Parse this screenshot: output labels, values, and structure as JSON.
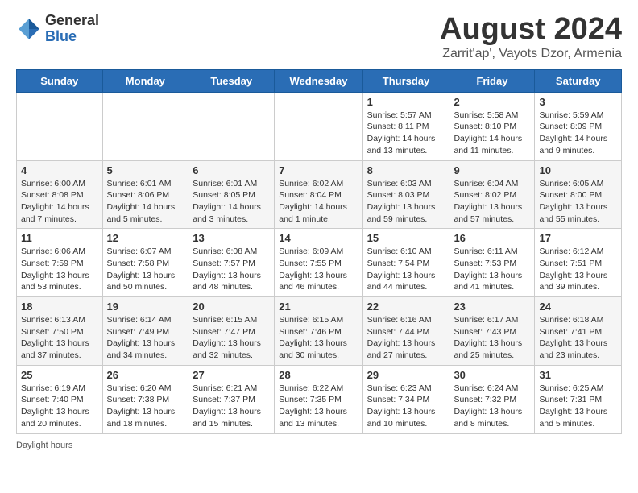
{
  "header": {
    "logo_general": "General",
    "logo_blue": "Blue",
    "main_title": "August 2024",
    "subtitle": "Zarrit'ap', Vayots Dzor, Armenia"
  },
  "weekdays": [
    "Sunday",
    "Monday",
    "Tuesday",
    "Wednesday",
    "Thursday",
    "Friday",
    "Saturday"
  ],
  "weeks": [
    [
      {
        "day": "",
        "info": ""
      },
      {
        "day": "",
        "info": ""
      },
      {
        "day": "",
        "info": ""
      },
      {
        "day": "",
        "info": ""
      },
      {
        "day": "1",
        "info": "Sunrise: 5:57 AM\nSunset: 8:11 PM\nDaylight: 14 hours and 13 minutes."
      },
      {
        "day": "2",
        "info": "Sunrise: 5:58 AM\nSunset: 8:10 PM\nDaylight: 14 hours and 11 minutes."
      },
      {
        "day": "3",
        "info": "Sunrise: 5:59 AM\nSunset: 8:09 PM\nDaylight: 14 hours and 9 minutes."
      }
    ],
    [
      {
        "day": "4",
        "info": "Sunrise: 6:00 AM\nSunset: 8:08 PM\nDaylight: 14 hours and 7 minutes."
      },
      {
        "day": "5",
        "info": "Sunrise: 6:01 AM\nSunset: 8:06 PM\nDaylight: 14 hours and 5 minutes."
      },
      {
        "day": "6",
        "info": "Sunrise: 6:01 AM\nSunset: 8:05 PM\nDaylight: 14 hours and 3 minutes."
      },
      {
        "day": "7",
        "info": "Sunrise: 6:02 AM\nSunset: 8:04 PM\nDaylight: 14 hours and 1 minute."
      },
      {
        "day": "8",
        "info": "Sunrise: 6:03 AM\nSunset: 8:03 PM\nDaylight: 13 hours and 59 minutes."
      },
      {
        "day": "9",
        "info": "Sunrise: 6:04 AM\nSunset: 8:02 PM\nDaylight: 13 hours and 57 minutes."
      },
      {
        "day": "10",
        "info": "Sunrise: 6:05 AM\nSunset: 8:00 PM\nDaylight: 13 hours and 55 minutes."
      }
    ],
    [
      {
        "day": "11",
        "info": "Sunrise: 6:06 AM\nSunset: 7:59 PM\nDaylight: 13 hours and 53 minutes."
      },
      {
        "day": "12",
        "info": "Sunrise: 6:07 AM\nSunset: 7:58 PM\nDaylight: 13 hours and 50 minutes."
      },
      {
        "day": "13",
        "info": "Sunrise: 6:08 AM\nSunset: 7:57 PM\nDaylight: 13 hours and 48 minutes."
      },
      {
        "day": "14",
        "info": "Sunrise: 6:09 AM\nSunset: 7:55 PM\nDaylight: 13 hours and 46 minutes."
      },
      {
        "day": "15",
        "info": "Sunrise: 6:10 AM\nSunset: 7:54 PM\nDaylight: 13 hours and 44 minutes."
      },
      {
        "day": "16",
        "info": "Sunrise: 6:11 AM\nSunset: 7:53 PM\nDaylight: 13 hours and 41 minutes."
      },
      {
        "day": "17",
        "info": "Sunrise: 6:12 AM\nSunset: 7:51 PM\nDaylight: 13 hours and 39 minutes."
      }
    ],
    [
      {
        "day": "18",
        "info": "Sunrise: 6:13 AM\nSunset: 7:50 PM\nDaylight: 13 hours and 37 minutes."
      },
      {
        "day": "19",
        "info": "Sunrise: 6:14 AM\nSunset: 7:49 PM\nDaylight: 13 hours and 34 minutes."
      },
      {
        "day": "20",
        "info": "Sunrise: 6:15 AM\nSunset: 7:47 PM\nDaylight: 13 hours and 32 minutes."
      },
      {
        "day": "21",
        "info": "Sunrise: 6:15 AM\nSunset: 7:46 PM\nDaylight: 13 hours and 30 minutes."
      },
      {
        "day": "22",
        "info": "Sunrise: 6:16 AM\nSunset: 7:44 PM\nDaylight: 13 hours and 27 minutes."
      },
      {
        "day": "23",
        "info": "Sunrise: 6:17 AM\nSunset: 7:43 PM\nDaylight: 13 hours and 25 minutes."
      },
      {
        "day": "24",
        "info": "Sunrise: 6:18 AM\nSunset: 7:41 PM\nDaylight: 13 hours and 23 minutes."
      }
    ],
    [
      {
        "day": "25",
        "info": "Sunrise: 6:19 AM\nSunset: 7:40 PM\nDaylight: 13 hours and 20 minutes."
      },
      {
        "day": "26",
        "info": "Sunrise: 6:20 AM\nSunset: 7:38 PM\nDaylight: 13 hours and 18 minutes."
      },
      {
        "day": "27",
        "info": "Sunrise: 6:21 AM\nSunset: 7:37 PM\nDaylight: 13 hours and 15 minutes."
      },
      {
        "day": "28",
        "info": "Sunrise: 6:22 AM\nSunset: 7:35 PM\nDaylight: 13 hours and 13 minutes."
      },
      {
        "day": "29",
        "info": "Sunrise: 6:23 AM\nSunset: 7:34 PM\nDaylight: 13 hours and 10 minutes."
      },
      {
        "day": "30",
        "info": "Sunrise: 6:24 AM\nSunset: 7:32 PM\nDaylight: 13 hours and 8 minutes."
      },
      {
        "day": "31",
        "info": "Sunrise: 6:25 AM\nSunset: 7:31 PM\nDaylight: 13 hours and 5 minutes."
      }
    ]
  ],
  "footer": {
    "daylight_hours": "Daylight hours"
  }
}
